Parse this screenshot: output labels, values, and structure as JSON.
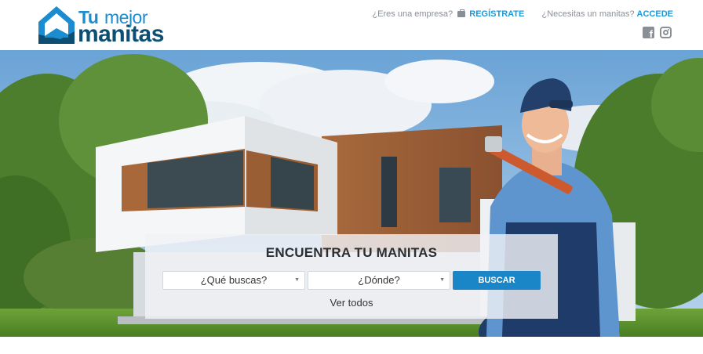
{
  "logo": {
    "tu": "Tu",
    "mejor": "mejor",
    "manitas": "manitas"
  },
  "topnav": {
    "company_question": "¿Eres una empresa?",
    "register_label": "REGÍSTRATE",
    "manitas_question": "¿Necesitas un manitas?",
    "login_label": "ACCEDE"
  },
  "icons": [
    "briefcase-icon",
    "facebook-icon",
    "instagram-icon",
    "chevron-down-icon",
    "logo-house-icon"
  ],
  "search": {
    "title": "ENCUENTRA TU MANITAS",
    "what_value": "¿Qué buscas?",
    "where_value": "¿Dónde?",
    "button_label": "BUSCAR",
    "view_all_label": "Ver todos"
  },
  "colors": {
    "brand_light": "#1a8ccf",
    "brand_dark": "#0d4f73",
    "button": "#1a86c8",
    "link": "#1a9ad9"
  }
}
